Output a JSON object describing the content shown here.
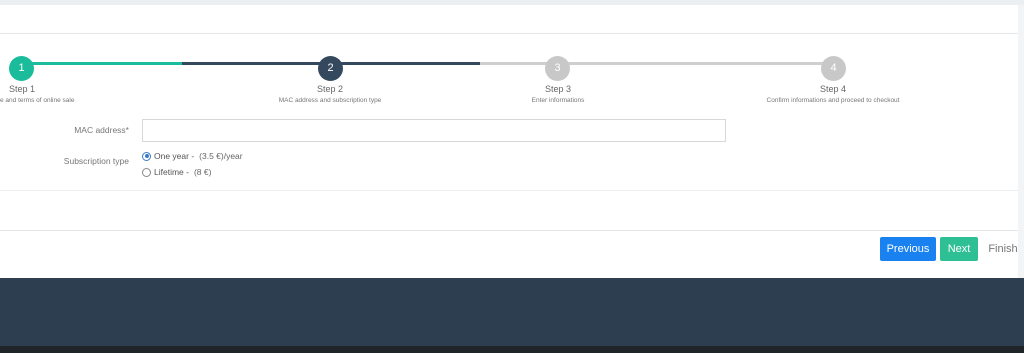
{
  "wizard": {
    "steps": [
      {
        "number": "1",
        "title": "Step 1",
        "desc": "e and terms of online sale",
        "state": "done"
      },
      {
        "number": "2",
        "title": "Step 2",
        "desc": "MAC address and subscription type",
        "state": "current"
      },
      {
        "number": "3",
        "title": "Step 3",
        "desc": "Enter informations",
        "state": "todo"
      },
      {
        "number": "4",
        "title": "Step 4",
        "desc": "Confirm informations and proceed to checkout",
        "state": "todo"
      }
    ]
  },
  "form": {
    "mac_label": "MAC address*",
    "mac_value": "",
    "subscription_label": "Subscription type",
    "options": [
      {
        "label": "One year -",
        "price": "(3.5 €)/year",
        "checked": true
      },
      {
        "label": "Lifetime -",
        "price": "(8 €)",
        "checked": false
      }
    ]
  },
  "actions": {
    "previous": "Previous",
    "next": "Next",
    "finish": "Finish"
  },
  "colors": {
    "done": "#1abc9c",
    "current": "#34495e",
    "todo": "#c8c8c8",
    "previous_button": "#1a82f0",
    "next_button": "#2fbf95",
    "footer": "#2c3e50"
  }
}
